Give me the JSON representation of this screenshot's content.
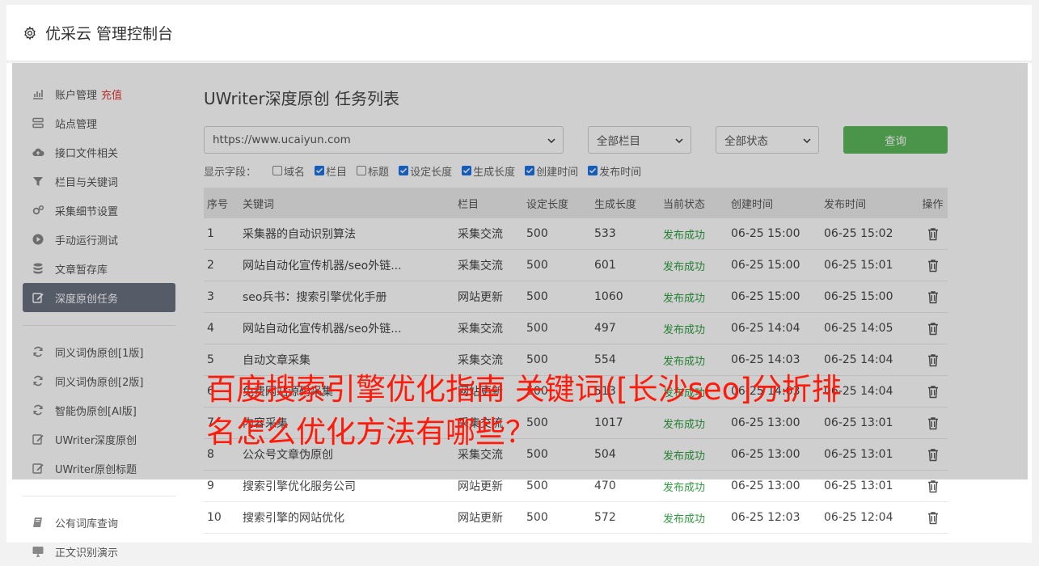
{
  "header": {
    "title": "优采云 管理控制台",
    "icon": "gear-icon"
  },
  "sidebar": {
    "group1": [
      {
        "label": "账户管理",
        "extra": "充值",
        "icon": "bar-chart-icon"
      },
      {
        "label": "站点管理",
        "icon": "server-icon"
      },
      {
        "label": "接口文件相关",
        "icon": "cloud-upload-icon"
      },
      {
        "label": "栏目与关键词",
        "icon": "filter-icon"
      },
      {
        "label": "采集细节设置",
        "icon": "gears-icon"
      },
      {
        "label": "手动运行测试",
        "icon": "play-icon"
      },
      {
        "label": "文章暂存库",
        "icon": "database-icon"
      },
      {
        "label": "深度原创任务",
        "icon": "edit-icon",
        "active": true
      }
    ],
    "group2": [
      {
        "label": "同义词伪原创[1版]",
        "icon": "refresh-icon"
      },
      {
        "label": "同义词伪原创[2版]",
        "icon": "refresh-icon"
      },
      {
        "label": "智能伪原创[AI版]",
        "icon": "refresh-icon"
      },
      {
        "label": "UWriter深度原创",
        "icon": "edit-icon"
      },
      {
        "label": "UWriter原创标题",
        "icon": "edit-icon"
      }
    ],
    "group3": [
      {
        "label": "公有词库查询",
        "icon": "book-icon"
      },
      {
        "label": "正文识别演示",
        "icon": "monitor-icon"
      }
    ]
  },
  "main": {
    "title": "UWriter深度原创 任务列表",
    "filters": {
      "site": "https://www.ucaiyun.com",
      "column": "全部栏目",
      "status": "全部状态",
      "query_label": "查询"
    },
    "fields_label": "显示字段：",
    "fields": [
      {
        "label": "域名",
        "checked": false
      },
      {
        "label": "栏目",
        "checked": true
      },
      {
        "label": "标题",
        "checked": false
      },
      {
        "label": "设定长度",
        "checked": true
      },
      {
        "label": "生成长度",
        "checked": true
      },
      {
        "label": "创建时间",
        "checked": true
      },
      {
        "label": "发布时间",
        "checked": true
      }
    ],
    "columns": [
      "序号",
      "关键词",
      "栏目",
      "设定长度",
      "生成长度",
      "当前状态",
      "创建时间",
      "发布时间",
      "操作"
    ],
    "rows": [
      [
        "1",
        "采集器的自动识别算法",
        "采集交流",
        "500",
        "533",
        "发布成功",
        "06-25 15:00",
        "06-25 15:02"
      ],
      [
        "2",
        "网站自动化宣传机器/seo外链...",
        "采集交流",
        "500",
        "601",
        "发布成功",
        "06-25 15:00",
        "06-25 15:01"
      ],
      [
        "3",
        "seo兵书：搜索引擎优化手册",
        "网站更新",
        "500",
        "1060",
        "发布成功",
        "06-25 15:00",
        "06-25 15:00"
      ],
      [
        "4",
        "网站自动化宣传机器/seo外链...",
        "采集交流",
        "500",
        "497",
        "发布成功",
        "06-25 14:04",
        "06-25 14:05"
      ],
      [
        "5",
        "自动文章采集",
        "采集交流",
        "500",
        "554",
        "发布成功",
        "06-25 14:03",
        "06-25 14:04"
      ],
      [
        "6",
        "免费网站源码采集",
        "网站更新",
        "500",
        "513",
        "发布成功",
        "06-25 14:03",
        "06-25 14:04"
      ],
      [
        "7",
        "内容采集",
        "采集交流",
        "500",
        "1017",
        "发布成功",
        "06-25 13:00",
        "06-25 13:01"
      ],
      [
        "8",
        "公众号文章伪原创",
        "采集交流",
        "500",
        "504",
        "发布成功",
        "06-25 13:00",
        "06-25 13:01"
      ],
      [
        "9",
        "搜索引擎优化服务公司",
        "网站更新",
        "500",
        "470",
        "发布成功",
        "06-25 13:00",
        "06-25 13:01"
      ],
      [
        "10",
        "搜索引擎的网站优化",
        "网站更新",
        "500",
        "572",
        "发布成功",
        "06-25 12:03",
        "06-25 12:04"
      ]
    ]
  },
  "overlay_text": "百度搜索引擎优化指南 关键词([长沙seo]分折排名怎么优化方法有哪些？"
}
